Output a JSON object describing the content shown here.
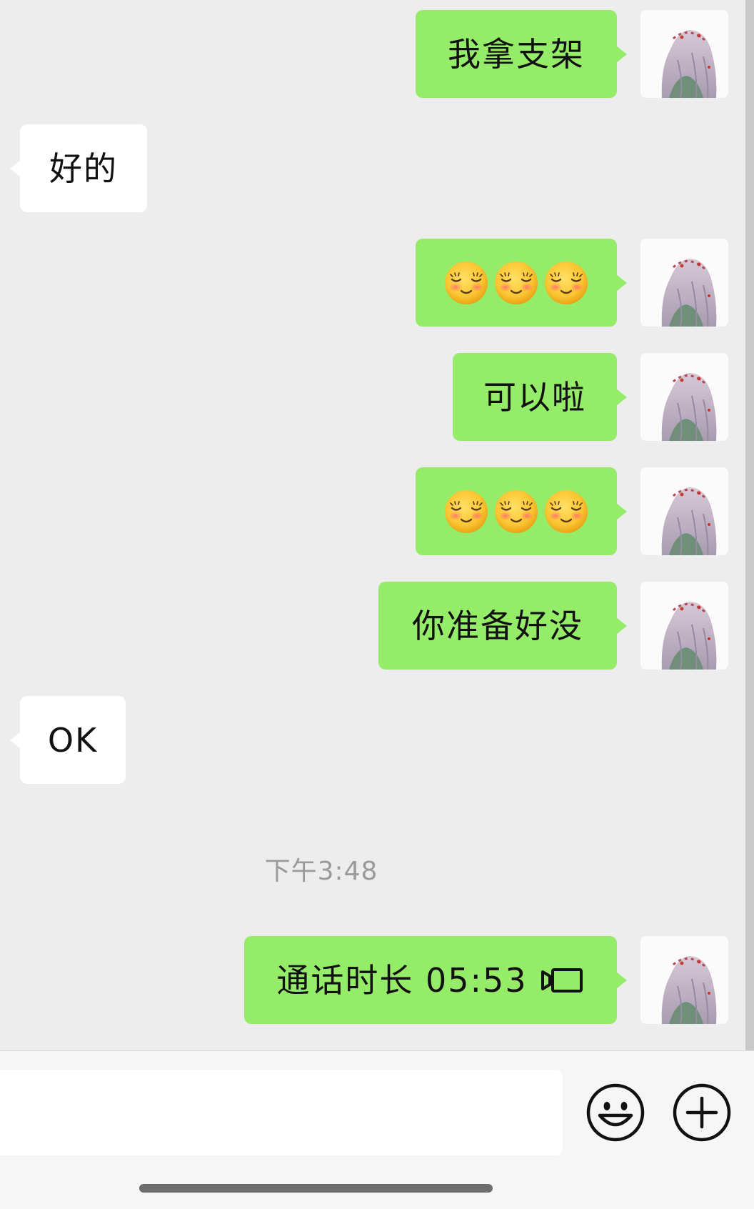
{
  "messages": [
    {
      "sender": "me",
      "text": "我拿支架"
    },
    {
      "sender": "them",
      "text": "好的"
    },
    {
      "sender": "me",
      "emojis": [
        "smiling-blushing-emoji",
        "smiling-blushing-emoji",
        "smiling-blushing-emoji"
      ]
    },
    {
      "sender": "me",
      "text": "可以啦"
    },
    {
      "sender": "me",
      "emojis": [
        "smiling-blushing-emoji",
        "smiling-blushing-emoji",
        "smiling-blushing-emoji"
      ]
    },
    {
      "sender": "me",
      "text": "你准备好没"
    },
    {
      "sender": "them",
      "text": "OK"
    },
    {
      "sender": "me",
      "call_label": "通话时长 05:53",
      "icon": "video-call-icon"
    }
  ],
  "timestamp": "下午3:48",
  "input_bar": {
    "placeholder": "",
    "emoji_button_icon": "smiley-face-icon",
    "more_button_icon": "plus-circle-icon"
  },
  "colors": {
    "background": "#ededed",
    "my_bubble": "#95ec69",
    "their_bubble": "#ffffff",
    "timestamp_text": "#9a9a9a"
  }
}
